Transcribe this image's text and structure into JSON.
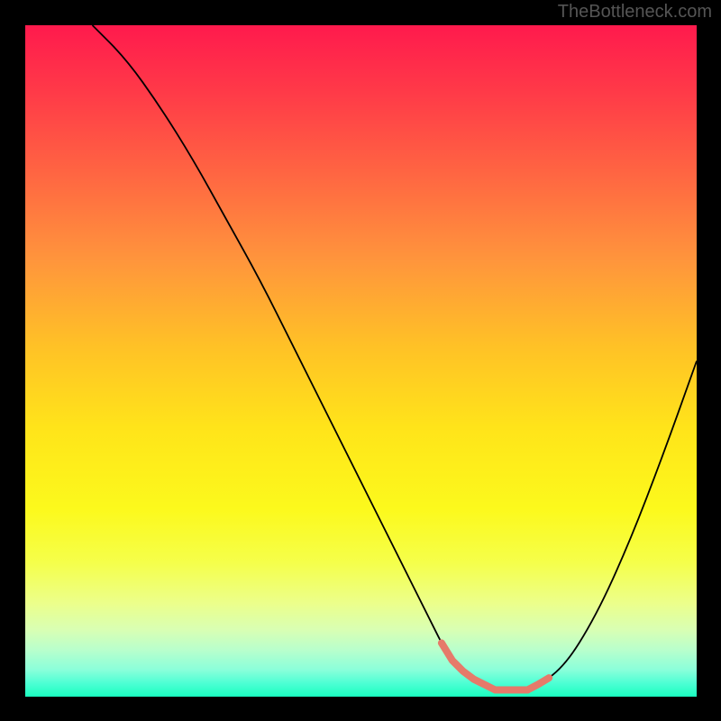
{
  "watermark": "TheBottleneck.com",
  "chart_data": {
    "type": "line",
    "title": "",
    "xlabel": "",
    "ylabel": "",
    "ylim": [
      0,
      100
    ],
    "xlim": [
      0,
      100
    ],
    "series": [
      {
        "name": "curve",
        "x": [
          10,
          15,
          20,
          25,
          30,
          35,
          40,
          45,
          50,
          55,
          60,
          63,
          66,
          70,
          75,
          80,
          85,
          90,
          95,
          100
        ],
        "y": [
          100,
          95,
          88,
          80,
          71,
          62,
          52,
          42,
          32,
          22,
          12,
          6,
          3,
          1,
          1,
          4,
          12,
          23,
          36,
          50
        ]
      }
    ],
    "highlight_range_x": [
      62,
      78
    ],
    "gradient_colors": {
      "top": "#ff1a4d",
      "mid": "#ffe41a",
      "bottom": "#1affc0"
    }
  }
}
